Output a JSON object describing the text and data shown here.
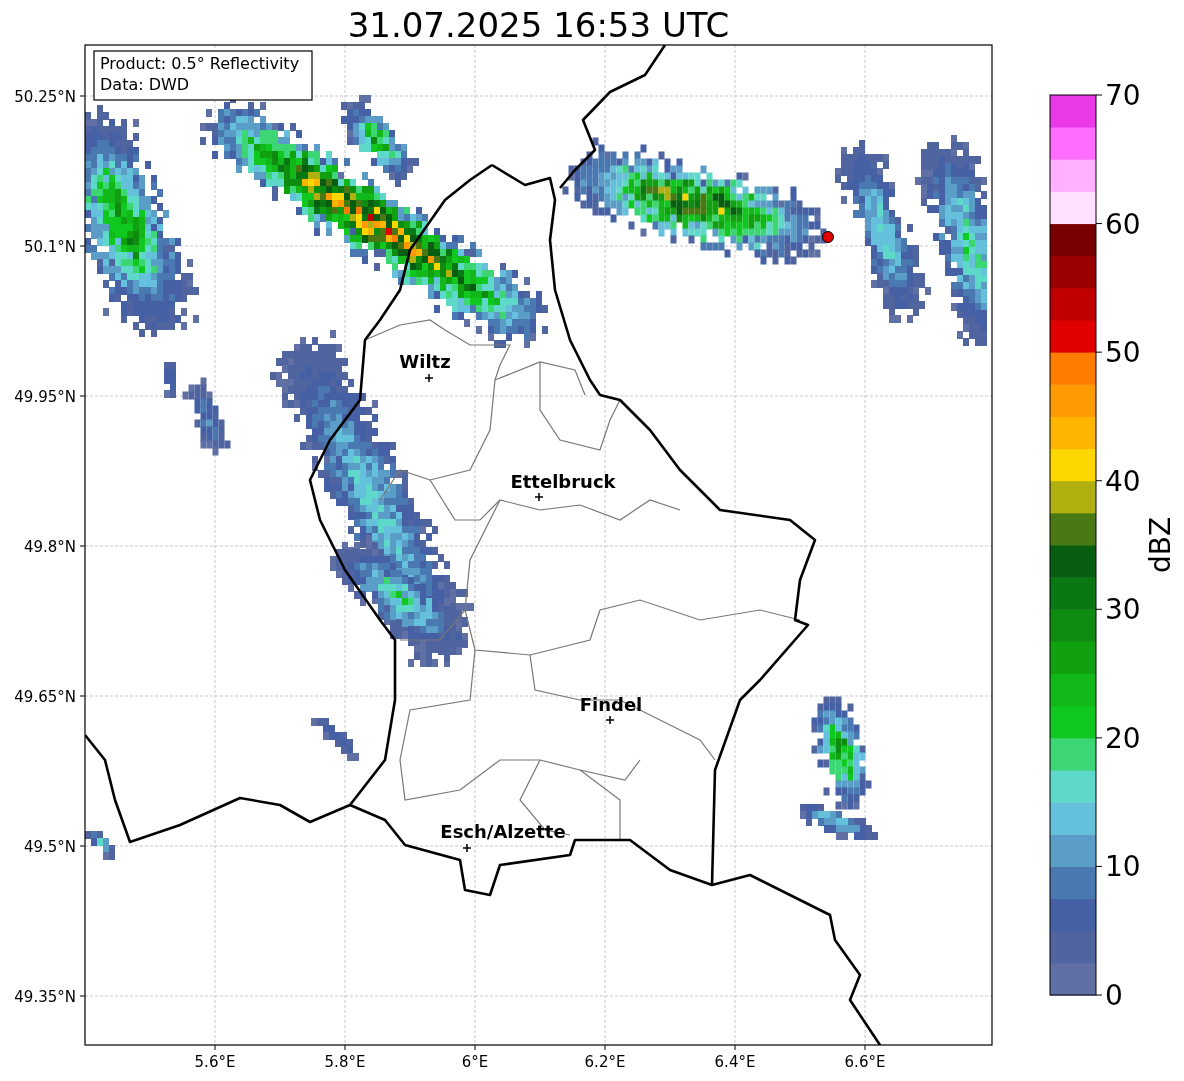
{
  "title": "31.07.2025 16:53 UTC",
  "info_box": [
    "Product: 0.5° Reflectivity",
    "Data: DWD"
  ],
  "map": {
    "y_ticks": [
      "50.25°N",
      "50.1°N",
      "49.95°N",
      "49.8°N",
      "49.65°N",
      "49.5°N",
      "49.35°N"
    ],
    "x_ticks": [
      "5.6°E",
      "5.8°E",
      "6°E",
      "6.2°E",
      "6.4°E",
      "6.6°E"
    ],
    "cities": [
      {
        "name": "Wiltz"
      },
      {
        "name": "Ettelbruck"
      },
      {
        "name": "Findel"
      },
      {
        "name": "Esch/Alzette"
      }
    ]
  },
  "colorbar": {
    "label": "dBZ",
    "ticks": [
      "70",
      "60",
      "50",
      "40",
      "30",
      "20",
      "10",
      "0"
    ],
    "bins": [
      {
        "color": "#6070a5"
      },
      {
        "color": "#5064a0"
      },
      {
        "color": "#4560a5"
      },
      {
        "color": "#4a78b0"
      },
      {
        "color": "#5a9ec8"
      },
      {
        "color": "#65c0dc"
      },
      {
        "color": "#5ed8c8"
      },
      {
        "color": "#3dd675"
      },
      {
        "color": "#10c820"
      },
      {
        "color": "#12b81a"
      },
      {
        "color": "#10a010"
      },
      {
        "color": "#0e8c10"
      },
      {
        "color": "#0a7812"
      },
      {
        "color": "#085e10"
      },
      {
        "color": "#4a7812"
      },
      {
        "color": "#b0b010"
      },
      {
        "color": "#ffd700"
      },
      {
        "color": "#ffb400"
      },
      {
        "color": "#ff9a00"
      },
      {
        "color": "#ff7c00"
      },
      {
        "color": "#e00000"
      },
      {
        "color": "#c00000"
      },
      {
        "color": "#9a0000"
      },
      {
        "color": "#780000"
      },
      {
        "color": "#ffe0ff"
      },
      {
        "color": "#ffb0ff"
      },
      {
        "color": "#ff6cff"
      },
      {
        "color": "#e838e8"
      }
    ]
  }
}
